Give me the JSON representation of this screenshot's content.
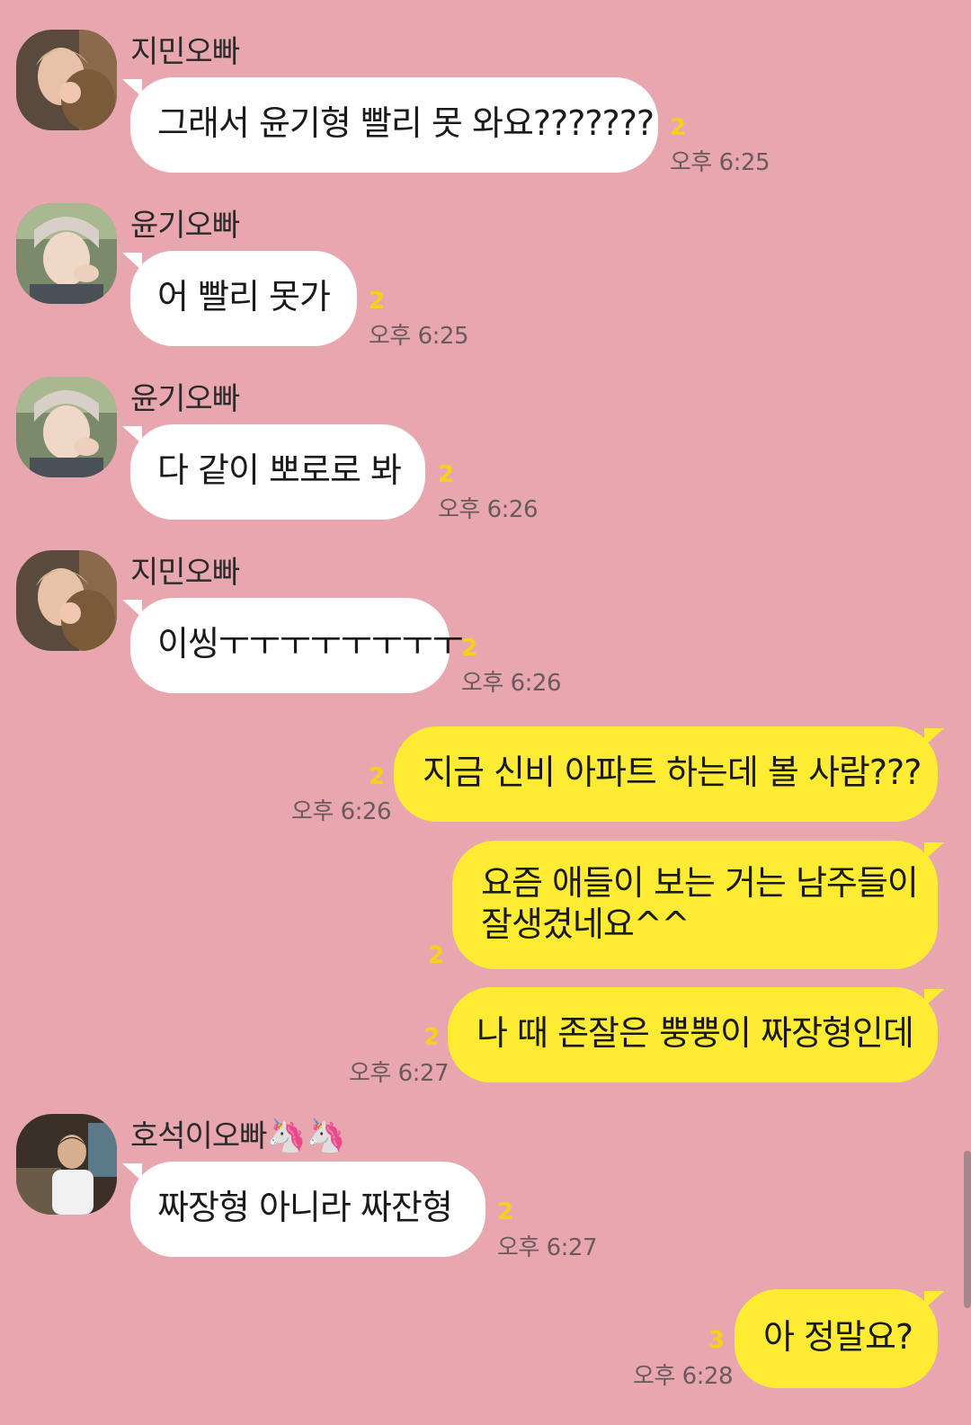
{
  "messages": [
    {
      "sender": "지민오빠",
      "text": "그래서 윤기형 빨리 못 와요???????",
      "unread": "2",
      "time": "오후 6:25",
      "direction": "in"
    },
    {
      "sender": "윤기오빠",
      "text": "어 빨리 못가",
      "unread": "2",
      "time": "오후 6:25",
      "direction": "in"
    },
    {
      "sender": "윤기오빠",
      "text": "다 같이 뽀로로 봐",
      "unread": "2",
      "time": "오후 6:26",
      "direction": "in"
    },
    {
      "sender": "지민오빠",
      "text": "이씽ㅜㅜㅜㅜㅜㅜㅜㅜ",
      "unread": "2",
      "time": "오후 6:26",
      "direction": "in"
    },
    {
      "text": "지금 신비 아파트 하는데 볼 사람???",
      "unread": "2",
      "time": "오후 6:26",
      "direction": "out"
    },
    {
      "text_line1": "요즘 애들이 보는 거는 남주들이",
      "text_line2": "잘생겼네요^^",
      "unread": "2",
      "direction": "out"
    },
    {
      "text": "나 때 존잘은 뿡뿡이 짜장형인데",
      "unread": "2",
      "time": "오후 6:27",
      "direction": "out"
    },
    {
      "sender": "호석이오빠",
      "sender_emoji": "🦄🦄",
      "text": "짜장형 아니라 짜잔형",
      "unread": "2",
      "time": "오후 6:27",
      "direction": "in"
    },
    {
      "text": "아 정말요?",
      "unread": "3",
      "time": "오후 6:28",
      "direction": "out"
    }
  ],
  "colors": {
    "background": "#E8A6AE",
    "incoming_bubble": "#FFFFFF",
    "outgoing_bubble": "#FEEB33",
    "unread_count": "#F5D21A"
  }
}
